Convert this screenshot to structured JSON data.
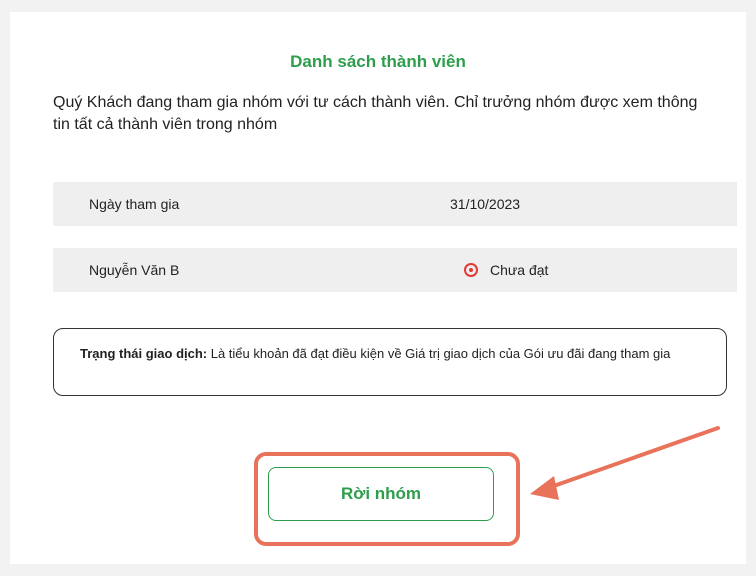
{
  "panel": {
    "title": "Danh sách thành viên",
    "description": "Quý Khách đang tham gia nhóm với tư cách thành viên. Chỉ trưởng nhóm được xem thông tin tất cả thành viên trong nhóm"
  },
  "join_row": {
    "label": "Ngày tham gia",
    "value": "31/10/2023"
  },
  "member_row": {
    "name": "Nguyễn Văn B",
    "status": "Chưa đạt",
    "status_icon": "not-achieved-icon",
    "status_color": "#e53935"
  },
  "note": {
    "label": "Trạng thái giao dịch:",
    "text": " Là tiểu khoản đã đạt điều kiện về Giá trị giao dịch của Gói ưu đãi đang tham gia"
  },
  "actions": {
    "leave_label": "Rời nhóm",
    "accent_color": "#2e9e4d"
  },
  "annotation": {
    "highlight_color": "#e8735a"
  }
}
